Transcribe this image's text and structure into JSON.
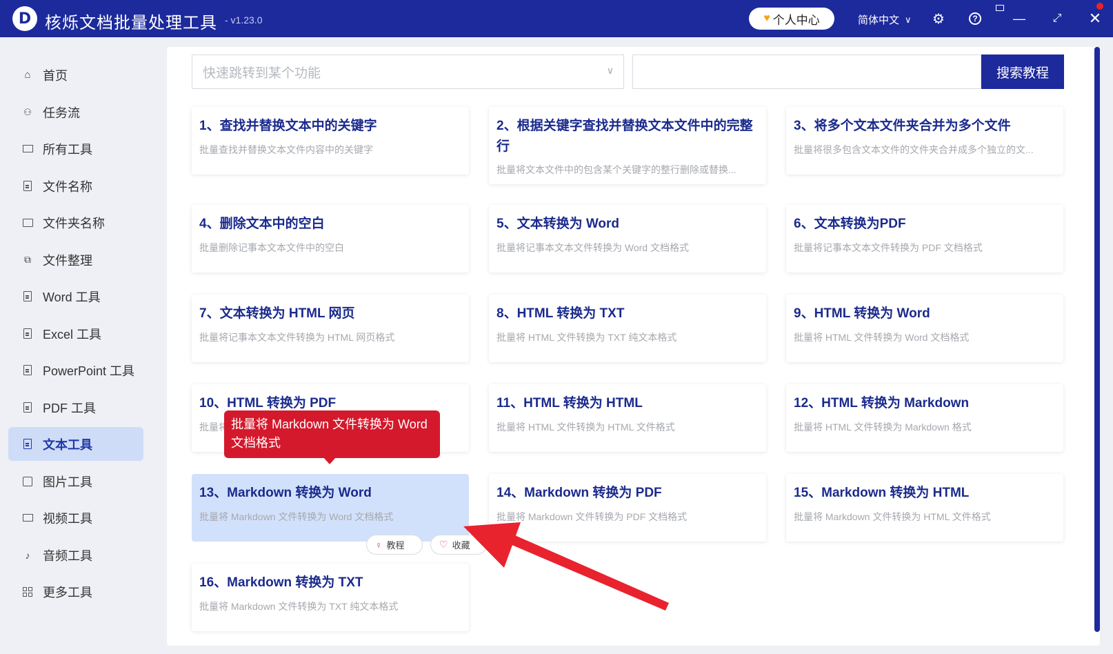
{
  "app": {
    "logo_letter": "D",
    "title": "核烁文档批量处理工具",
    "version": "- v1.23.0",
    "user_center": "个人中心",
    "language": "简体中文"
  },
  "sidebar": {
    "items": [
      {
        "label": "首页",
        "icon": "home-icon"
      },
      {
        "label": "任务流",
        "icon": "workflow-icon"
      },
      {
        "label": "所有工具",
        "icon": "monitor-icon"
      },
      {
        "label": "文件名称",
        "icon": "file-copy-icon"
      },
      {
        "label": "文件夹名称",
        "icon": "folder-icon"
      },
      {
        "label": "文件整理",
        "icon": "organize-icon"
      },
      {
        "label": "Word 工具",
        "icon": "word-file-icon"
      },
      {
        "label": "Excel 工具",
        "icon": "excel-file-icon"
      },
      {
        "label": "PowerPoint 工具",
        "icon": "ppt-file-icon"
      },
      {
        "label": "PDF 工具",
        "icon": "pdf-file-icon"
      },
      {
        "label": "文本工具",
        "icon": "text-file-icon",
        "active": true
      },
      {
        "label": "图片工具",
        "icon": "image-icon"
      },
      {
        "label": "视频工具",
        "icon": "video-icon"
      },
      {
        "label": "音频工具",
        "icon": "microphone-icon"
      },
      {
        "label": "更多工具",
        "icon": "grid-icon"
      }
    ]
  },
  "search": {
    "quick_placeholder": "快速跳转到某个功能",
    "tutorial_button": "搜索教程"
  },
  "cards": [
    {
      "title": "1、查找并替换文本中的关键字",
      "desc": "批量查找并替换文本文件内容中的关键字"
    },
    {
      "title": "2、根据关键字查找并替换文本文件中的完整行",
      "desc": "批量将文本文件中的包含某个关键字的整行删除或替换..."
    },
    {
      "title": "3、将多个文本文件夹合并为多个文件",
      "desc": "批量将很多包含文本文件的文件夹合并成多个独立的文..."
    },
    {
      "title": "4、删除文本中的空白",
      "desc": "批量删除记事本文本文件中的空白"
    },
    {
      "title": "5、文本转换为 Word",
      "desc": "批量将记事本文本文件转换为 Word 文档格式"
    },
    {
      "title": "6、文本转换为PDF",
      "desc": "批量将记事本文本文件转换为 PDF 文档格式"
    },
    {
      "title": "7、文本转换为 HTML 网页",
      "desc": "批量将记事本文本文件转换为 HTML 网页格式"
    },
    {
      "title": "8、HTML 转换为 TXT",
      "desc": "批量将 HTML 文件转换为 TXT 纯文本格式"
    },
    {
      "title": "9、HTML 转换为 Word",
      "desc": "批量将 HTML 文件转换为 Word 文档格式"
    },
    {
      "title": "10、HTML 转换为 PDF",
      "desc": "批量将"
    },
    {
      "title": "11、HTML 转换为 HTML",
      "desc": "批量将 HTML 文件转换为 HTML 文件格式"
    },
    {
      "title": "12、HTML 转换为 Markdown",
      "desc": "批量将 HTML 文件转换为 Markdown 格式"
    },
    {
      "title": "13、Markdown 转换为 Word",
      "desc": "批量将 Markdown 文件转换为 Word 文档格式"
    },
    {
      "title": "14、Markdown 转换为 PDF",
      "desc": "批量将 Markdown 文件转换为 PDF 文档格式"
    },
    {
      "title": "15、Markdown 转换为 HTML",
      "desc": "批量将 Markdown 文件转换为 HTML 文件格式"
    },
    {
      "title": "16、Markdown 转换为 TXT",
      "desc": "批量将 Markdown 文件转换为 TXT 纯文本格式"
    }
  ],
  "tooltip": "批量将 Markdown 文件转换为 Word 文档格式",
  "card_actions": {
    "tutorial": "教程",
    "favorite": "收藏"
  },
  "colors": {
    "brand": "#1d2a9c",
    "active_bg": "#cfdcf8",
    "tooltip": "#d4192c",
    "arrow": "#e8232e",
    "card_title": "#1a2a8c"
  }
}
